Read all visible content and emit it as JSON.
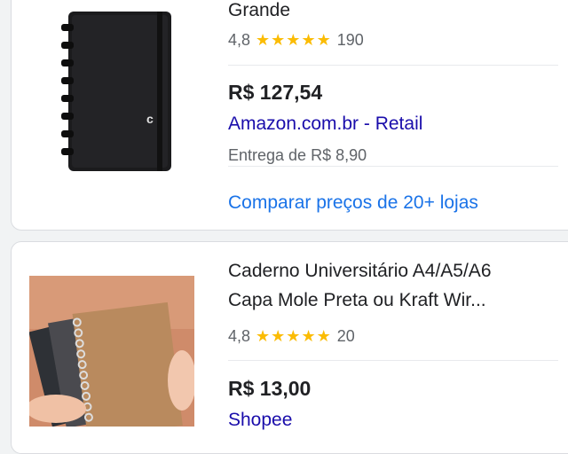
{
  "products": [
    {
      "title": "Grande",
      "rating": "4,8",
      "stars": "★★★★★",
      "reviews": "190",
      "price": "R$ 127,54",
      "seller": "Amazon.com.br - Retail",
      "delivery": "Entrega de R$ 8,90",
      "compare": "Comparar preços de 20+ lojas"
    },
    {
      "title_line1": "Caderno Universitário A4/A5/A6",
      "title_line2": "Capa Mole Preta ou Kraft Wir...",
      "rating": "4,8",
      "stars": "★★★★★",
      "reviews": "20",
      "price": "R$ 13,00",
      "seller": "Shopee"
    }
  ],
  "colors": {
    "star": "#fbbc04",
    "link": "#1a73e8",
    "seller": "#1a0dab",
    "text": "#202124",
    "muted": "#5f6368"
  },
  "icons": {
    "product1_image": "black-notebook-image",
    "product2_image": "kraft-notebooks-image"
  }
}
